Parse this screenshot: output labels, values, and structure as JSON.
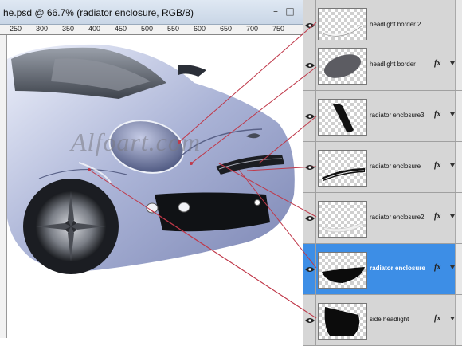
{
  "window": {
    "title": "he.psd @ 66.7% (radiator enclosure, RGB/8)",
    "minimize_glyph": "–",
    "maximize_glyph": "□"
  },
  "ruler": {
    "ticks": [
      "250",
      "300",
      "350",
      "400",
      "450",
      "500",
      "550",
      "600",
      "650",
      "700",
      "750",
      "800",
      "850",
      "900",
      "950"
    ]
  },
  "canvas": {
    "watermark": "Alfoart.com"
  },
  "colors": {
    "selection": "#3d8ee6",
    "guide_line": "#c0394a",
    "panel_bg": "#d6d6d6"
  },
  "layers": [
    {
      "name": "headlight border 2",
      "icon": "thin-stroke",
      "selected": false,
      "has_fx": false
    },
    {
      "name": "headlight border",
      "icon": "dark-ellipse",
      "selected": false,
      "has_fx": true
    },
    {
      "name": "radiator enclosure3",
      "icon": "dark-diagonal",
      "selected": false,
      "has_fx": true
    },
    {
      "name": "radiator enclosure",
      "icon": "curved-stripes",
      "selected": false,
      "has_fx": true
    },
    {
      "name": "radiator enclosure2",
      "icon": "light-sweep",
      "selected": false,
      "has_fx": true
    },
    {
      "name": "radiator enclosure",
      "icon": "black-wedge",
      "selected": true,
      "has_fx": true
    },
    {
      "name": "side headlight",
      "icon": "black-shape",
      "selected": false,
      "has_fx": true
    }
  ],
  "fx_label": "fx"
}
